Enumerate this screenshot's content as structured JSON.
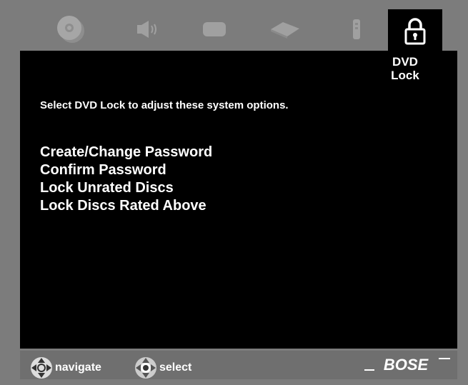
{
  "header": {
    "icons": [
      "disc-icon",
      "speaker-icon",
      "screen-icon",
      "console-icon",
      "remote-icon",
      "lock-icon"
    ],
    "active_tab_label": "DVD Lock"
  },
  "main": {
    "instructions": "Select DVD Lock to adjust these system options.",
    "menu": [
      "Create/Change Password",
      "Confirm Password",
      "Lock Unrated Discs",
      "Lock Discs Rated Above"
    ]
  },
  "footer": {
    "navigate_label": "navigate",
    "select_label": "select",
    "brand": "BOSE"
  },
  "colors": {
    "background": "#7c7c7c",
    "panel": "#000000",
    "footer": "#6f6f6f",
    "inactive_icon": "#9a9a9a",
    "text": "#ffffff"
  }
}
